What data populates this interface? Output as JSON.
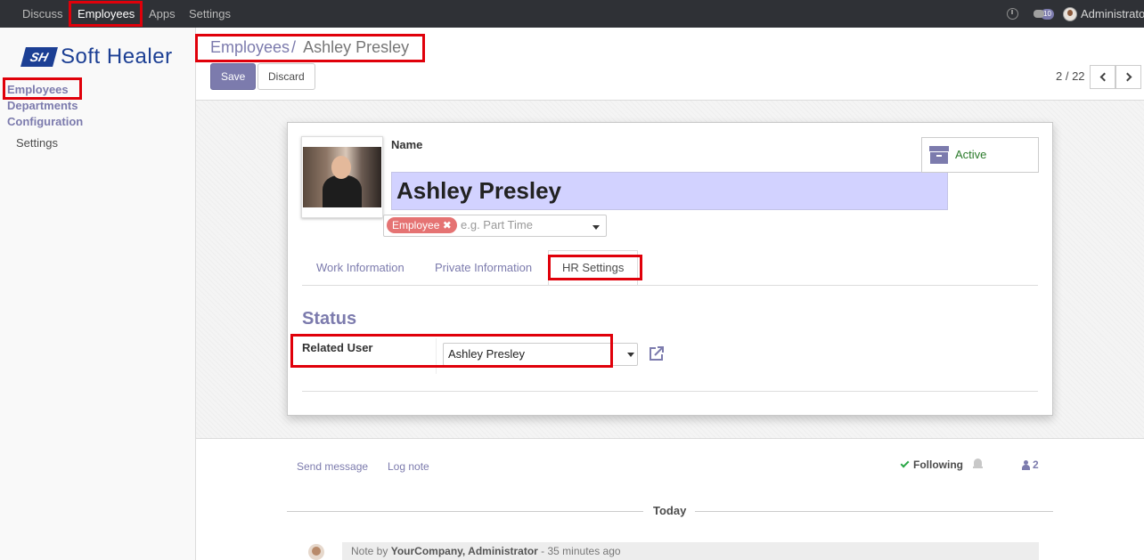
{
  "topbar": {
    "menu": [
      "Discuss",
      "Employees",
      "Apps",
      "Settings"
    ],
    "badge_count": "10",
    "user_name": "Administrator"
  },
  "sidebar": {
    "logo_mark": "SH",
    "logo_text": "Soft Healer",
    "items": [
      "Employees",
      "Departments",
      "Configuration"
    ],
    "sub_items": [
      "Settings"
    ]
  },
  "control_panel": {
    "breadcrumb_parent": "Employees",
    "breadcrumb_separator": "/",
    "breadcrumb_current": "Ashley Presley",
    "save_label": "Save",
    "discard_label": "Discard",
    "pager": "2 / 22"
  },
  "form": {
    "name_label": "Name",
    "name_value": "Ashley Presley",
    "tag": "Employee",
    "tags_placeholder": "e.g. Part Time",
    "active_label": "Active",
    "tabs": [
      "Work Information",
      "Private Information",
      "HR Settings"
    ],
    "active_tab": "HR Settings",
    "section_title": "Status",
    "related_user_label": "Related User",
    "related_user_value": "Ashley Presley"
  },
  "chatter": {
    "send_message": "Send message",
    "log_note": "Log note",
    "following": "Following",
    "followers_count": "2",
    "day_label": "Today",
    "note_prefix": "Note by",
    "note_author": "YourCompany, Administrator",
    "note_time": "- 35 minutes ago"
  },
  "colors": {
    "brand": "#7c7bad",
    "highlight": "#e0000a",
    "name_bg": "#d2d2ff",
    "tag_bg": "#e57373"
  }
}
